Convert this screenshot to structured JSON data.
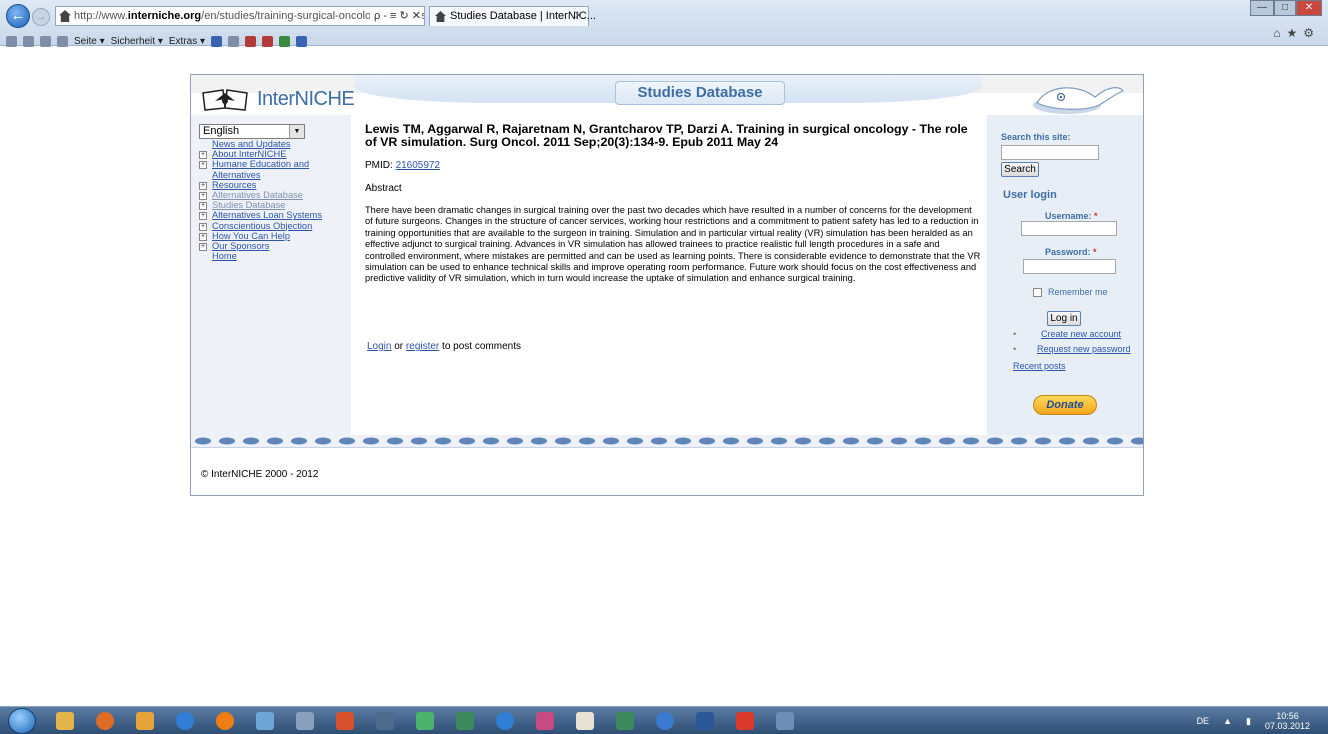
{
  "browser": {
    "url_prefix": "http://www.",
    "url_host": "interniche.org",
    "url_path": "/en/studies/training-surgical-oncology-role-vr-simulati",
    "url_tools": "ρ - ≡ ↻ ✕",
    "tab_title": "Studies Database | InterNIC...",
    "commandbar": [
      "Seite ▾",
      "Sicherheit ▾",
      "Extras ▾"
    ]
  },
  "site": {
    "logo_text": "InterNICHE",
    "header_title": "Studies Database",
    "language": "English",
    "menu": [
      {
        "label": "News and Updates",
        "expandable": false,
        "visited": false
      },
      {
        "label": "About InterNICHE",
        "expandable": true,
        "visited": false
      },
      {
        "label": "Humane Education and Alternatives",
        "expandable": true,
        "visited": false
      },
      {
        "label": "Resources",
        "expandable": true,
        "visited": false
      },
      {
        "label": "Alternatives Database",
        "expandable": true,
        "visited": true
      },
      {
        "label": "Studies Database",
        "expandable": true,
        "visited": true
      },
      {
        "label": "Alternatives Loan Systems",
        "expandable": true,
        "visited": false
      },
      {
        "label": "Conscientious Objection",
        "expandable": true,
        "visited": false
      },
      {
        "label": "How You Can Help",
        "expandable": true,
        "visited": false
      },
      {
        "label": "Our Sponsors",
        "expandable": true,
        "visited": false
      },
      {
        "label": "Home",
        "expandable": false,
        "visited": false
      }
    ]
  },
  "article": {
    "title": "Lewis TM, Aggarwal R, Rajaretnam N, Grantcharov TP, Darzi A. Training in surgical oncology - The role of VR simulation. Surg Oncol. 2011 Sep;20(3):134-9. Epub 2011 May 24",
    "pmid_label": "PMID:",
    "pmid": "21605972",
    "abstract_heading": "Abstract",
    "abstract": "There have been dramatic changes in surgical training over the past two decades which have resulted in a number of concerns for the development of future surgeons. Changes in the structure of cancer services, working hour restrictions and a commitment to patient safety has led to a reduction in training opportunities that are available to the surgeon in training. Simulation and in particular virtual reality (VR) simulation has been heralded as an effective adjunct to surgical training. Advances in VR simulation has allowed trainees to practice realistic full length procedures in a safe and controlled environment, where mistakes are permitted and can be used as learning points. There is considerable evidence to demonstrate that the VR simulation can be used to enhance technical skills and improve operating room performance. Future work should focus on the cost effectiveness and predictive validity of VR simulation, which in turn would increase the uptake of simulation and enhance surgical training.",
    "login_link": "Login",
    "or_text": " or ",
    "register_link": "register",
    "comment_suffix": " to post comments"
  },
  "sidebar_right": {
    "search_label": "Search this site:",
    "search_button": "Search",
    "user_login_heading": "User login",
    "username_label": "Username:",
    "password_label": "Password:",
    "required_mark": "*",
    "remember_me": "Remember me",
    "login_button": "Log in",
    "create_account": "Create new account",
    "request_password": "Request new password",
    "recent_posts": "Recent posts",
    "donate": "Donate"
  },
  "footer": {
    "copyright": "© InterNICHE 2000 - 2012"
  },
  "taskbar": {
    "language": "DE",
    "time": "10:56",
    "date": "07.03.2012"
  },
  "colors": {
    "brand_blue": "#3e6ea5",
    "link_blue": "#2d56a8",
    "panel_bg": "#eef2f8"
  }
}
